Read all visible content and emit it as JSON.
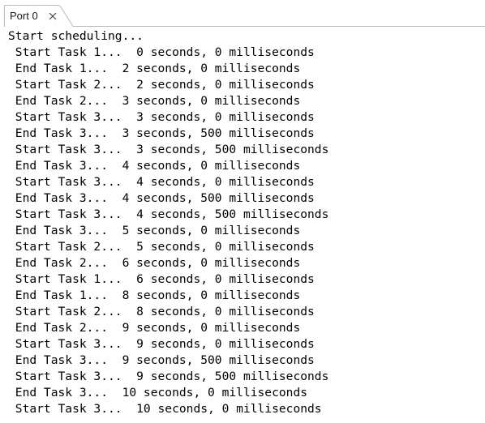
{
  "tab": {
    "label": "Port 0",
    "close_icon": "close-icon"
  },
  "console": {
    "lines": [
      "Start scheduling...",
      " Start Task 1...  0 seconds, 0 milliseconds",
      " End Task 1...  2 seconds, 0 milliseconds",
      " Start Task 2...  2 seconds, 0 milliseconds",
      " End Task 2...  3 seconds, 0 milliseconds",
      " Start Task 3...  3 seconds, 0 milliseconds",
      " End Task 3...  3 seconds, 500 milliseconds",
      " Start Task 3...  3 seconds, 500 milliseconds",
      " End Task 3...  4 seconds, 0 milliseconds",
      " Start Task 3...  4 seconds, 0 milliseconds",
      " End Task 3...  4 seconds, 500 milliseconds",
      " Start Task 3...  4 seconds, 500 milliseconds",
      " End Task 3...  5 seconds, 0 milliseconds",
      " Start Task 2...  5 seconds, 0 milliseconds",
      " End Task 2...  6 seconds, 0 milliseconds",
      " Start Task 1...  6 seconds, 0 milliseconds",
      " End Task 1...  8 seconds, 0 milliseconds",
      " Start Task 2...  8 seconds, 0 milliseconds",
      " End Task 2...  9 seconds, 0 milliseconds",
      " Start Task 3...  9 seconds, 0 milliseconds",
      " End Task 3...  9 seconds, 500 milliseconds",
      " Start Task 3...  9 seconds, 500 milliseconds",
      " End Task 3...  10 seconds, 0 milliseconds",
      " Start Task 3...  10 seconds, 0 milliseconds"
    ]
  }
}
